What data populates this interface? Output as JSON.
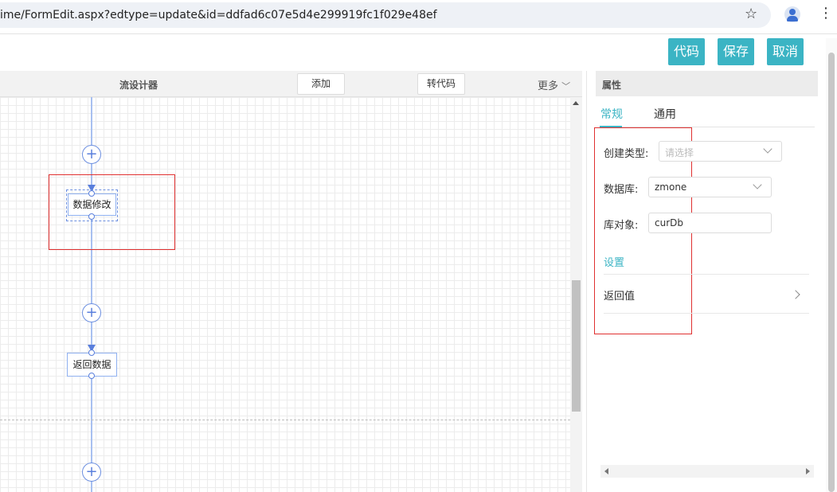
{
  "browser": {
    "url": "ime/FormEdit.aspx?edtype=update&id=ddfad6c07e5d4e299919fc1f029e48ef",
    "icons": [
      "star-icon",
      "profile-icon",
      "more-vert-icon"
    ]
  },
  "toolbar": {
    "code_label": "代码",
    "save_label": "保存",
    "cancel_label": "取消",
    "accent_color": "#3bb4c4"
  },
  "designer": {
    "title": "流设计器",
    "add_label": "添加",
    "to_code_label": "转代码",
    "more_label": "更多",
    "nodes": [
      {
        "label": "数据修改"
      },
      {
        "label": "返回数据"
      }
    ]
  },
  "properties": {
    "header": "属性",
    "tabs": [
      {
        "label": "常规",
        "active": true
      },
      {
        "label": "通用",
        "active": false
      }
    ],
    "fields": {
      "create_type_label": "创建类型:",
      "create_type_placeholder": "请选择",
      "database_label": "数据库:",
      "database_value": "zmone",
      "object_label": "库对象:",
      "object_value": "curDb"
    },
    "settings_label": "设置",
    "return_value_label": "返回值"
  }
}
